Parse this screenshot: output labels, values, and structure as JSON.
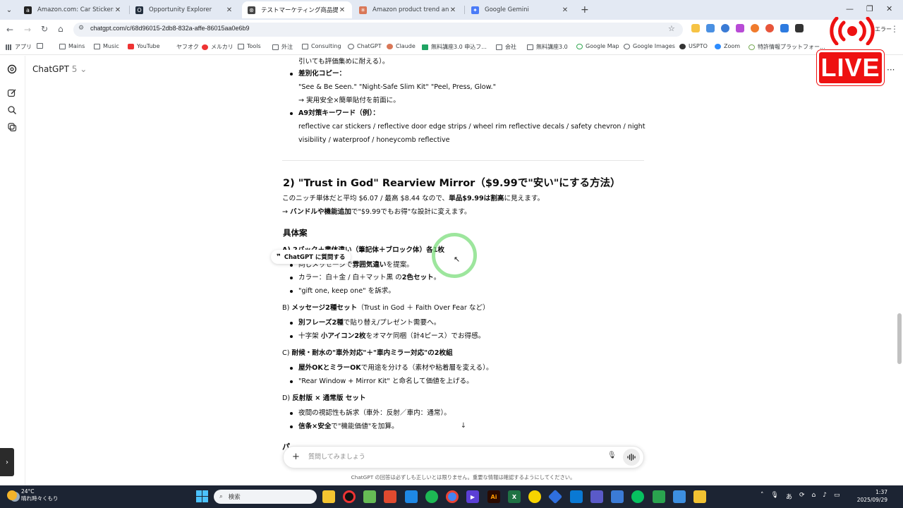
{
  "browser": {
    "tabs": [
      {
        "title": "Amazon.com: Car Stickers",
        "favicon_color": "#222",
        "favicon_glyph": "a",
        "active": false
      },
      {
        "title": "Opportunity Explorer",
        "favicon_color": "#232f3e",
        "favicon_glyph": "O",
        "active": false
      },
      {
        "title": "テストマーケティング商品提案",
        "favicon_color": "#444",
        "favicon_glyph": "⊛",
        "active": true
      },
      {
        "title": "Amazon product trend analysis",
        "favicon_color": "#d97757",
        "favicon_glyph": "✳",
        "active": false
      },
      {
        "title": "Google Gemini",
        "favicon_color": "#4a7bf7",
        "favicon_glyph": "✦",
        "active": false
      }
    ],
    "url": "chatgpt.com/c/68d96015-2db8-832a-affe-86015aa0e6b9",
    "profile_label": "エラー",
    "bookmarks": [
      {
        "label": "アプリ",
        "icon": "apps-icon"
      },
      {
        "label": "Mains",
        "icon": "folder-icon"
      },
      {
        "label": "Music",
        "icon": "folder-icon"
      },
      {
        "label": "YouTube",
        "icon": "youtube-icon"
      },
      {
        "label": "ヤフオク",
        "icon": "yahoo-auction-icon"
      },
      {
        "label": "メルカリ",
        "icon": "mercari-icon"
      },
      {
        "label": "Tools",
        "icon": "folder-icon"
      },
      {
        "label": "外注",
        "icon": "folder-icon"
      },
      {
        "label": "Consulting",
        "icon": "folder-icon"
      },
      {
        "label": "ChatGPT",
        "icon": "chatgpt-icon"
      },
      {
        "label": "Claude",
        "icon": "claude-icon"
      },
      {
        "label": "無料講座3.0 申込フ...",
        "icon": "sheet-icon"
      },
      {
        "label": "会社",
        "icon": "folder-icon"
      },
      {
        "label": "無料講座3.0",
        "icon": "folder-icon"
      },
      {
        "label": "Google Map",
        "icon": "map-pin-icon"
      },
      {
        "label": "Google Images",
        "icon": "globe-icon"
      },
      {
        "label": "USPTO",
        "icon": "uspto-icon"
      },
      {
        "label": "Zoom",
        "icon": "zoom-icon"
      },
      {
        "label": "特許情報プラットフォー...",
        "icon": "jplat-icon"
      }
    ]
  },
  "live_badge": "LIVE",
  "app": {
    "model_name": "ChatGPT",
    "model_version": "5"
  },
  "message": {
    "top_lines": [
      {
        "text": "引いても評価集めに耐える）。",
        "bold": false,
        "bullet": false
      },
      {
        "label": "差別化コピー：",
        "bullet": true
      },
      {
        "text": "\"See & Be Seen.\" \"Night-Safe Slim Kit\" \"Peel, Press, Glow.\"",
        "bullet": false
      },
      {
        "text": "→ 実用安全×簡単貼付を前面に。",
        "bullet": false
      },
      {
        "label": "A9対策キーワード（例）：",
        "bullet": true
      },
      {
        "text": "reflective car stickers / reflective door edge strips / wheel rim reflective decals / safety chevron / night",
        "bullet": false
      },
      {
        "text": "visibility / waterproof / honeycomb reflective",
        "bullet": false
      }
    ],
    "section_title": "2) \"Trust in God\" Rearview Mirror（$9.99で\"安い\"にする方法）",
    "intro_1_pre": "このニッチ単体だと平均 $6.07 / 最高 $8.44 なので、",
    "intro_1_bold": "単品$9.99は割高",
    "intro_1_post": "に見えます。",
    "intro_2_pre": "→ ",
    "intro_2_bold": "バンドルや機能追加",
    "intro_2_post": "で\"$9.99でもお得\"な設計に変えます。",
    "plan_heading": "具体案",
    "option_a": "A) 2パック＋書体違い（筆記体＋ブロック体）各1枚",
    "option_a_items": [
      {
        "pre": "同じメッセージで",
        "bold": "雰囲気違い",
        "post": "を提案。"
      },
      {
        "pre": "カラー：白＋金 / 白＋マット黒 の",
        "bold": "2色セット",
        "post": "。"
      },
      {
        "pre": "\"gift one, keep one\" を訴求。",
        "bold": "",
        "post": ""
      }
    ],
    "option_b_pre": "B) ",
    "option_b_bold": "メッセージ2種セット",
    "option_b_post": "（Trust in God ＋ Faith Over Fear など）",
    "option_b_items": [
      {
        "pre": "",
        "bold": "別フレーズ2種",
        "post": "で貼り替え/プレゼント需要へ。"
      },
      {
        "pre": "十字架 ",
        "bold": "小アイコン2枚",
        "post": "をオマケ同梱（計4ピース）でお得感。"
      }
    ],
    "option_c_pre": "C) ",
    "option_c_bold": "耐候・耐水の\"車外対応\"＋\"車内ミラー対応\"の2枚組",
    "option_c_items": [
      {
        "pre": "",
        "bold": "屋外OKとミラーOK",
        "post": "で用途を分ける（素材や粘着層を変える）。"
      },
      {
        "pre": "\"Rear Window + Mirror Kit\" と命名して価値を上げる。",
        "bold": "",
        "post": ""
      }
    ],
    "option_d_pre": "D) ",
    "option_d_bold": "反射版 × 通常版 セット",
    "option_d_items": [
      {
        "pre": "夜間の視認性も訴求（車外：反射／車内：通常）。",
        "bold": "",
        "post": ""
      },
      {
        "pre": "",
        "bold": "信条×安全",
        "post": "で\"機能価値\"を加算。"
      }
    ],
    "cut_off": "パ"
  },
  "quote_popover": "ChatGPT に質問する",
  "composer": {
    "placeholder": "質問してみましょう"
  },
  "disclaimer": "ChatGPT の回答は必ずしも正しいとは限りません。重要な情報は確認するようにしてください。",
  "taskbar": {
    "temperature": "24°C",
    "weather": "晴れ時々くもり",
    "search_label": "検索",
    "time": "1:37",
    "date": "2025/09/29",
    "ime": "あ"
  }
}
